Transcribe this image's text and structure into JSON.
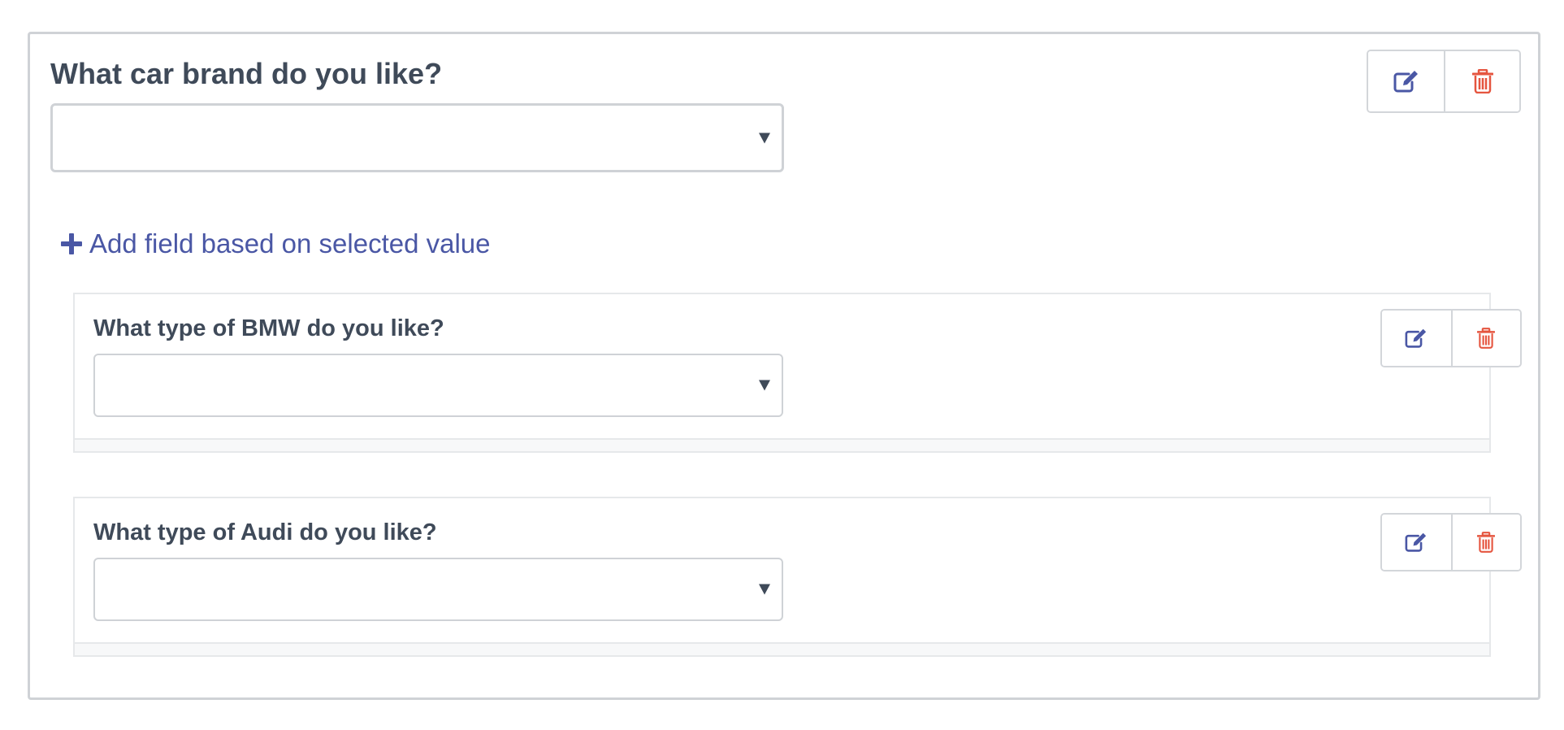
{
  "main": {
    "question_label": "What car brand do you like?",
    "select_value": "",
    "add_field_label": "Add field based on selected value"
  },
  "sub_fields": [
    {
      "question_label": "What type of BMW do you like?",
      "select_value": ""
    },
    {
      "question_label": "What type of Audi do you like?",
      "select_value": ""
    }
  ],
  "icons": {
    "edit": "edit-icon",
    "delete": "trash-icon",
    "add": "plus-icon",
    "dropdown": "caret-down-icon"
  },
  "colors": {
    "text": "#3f4a59",
    "accent": "#4a57a5",
    "delete": "#e5553f",
    "border": "#cfd2d6"
  }
}
